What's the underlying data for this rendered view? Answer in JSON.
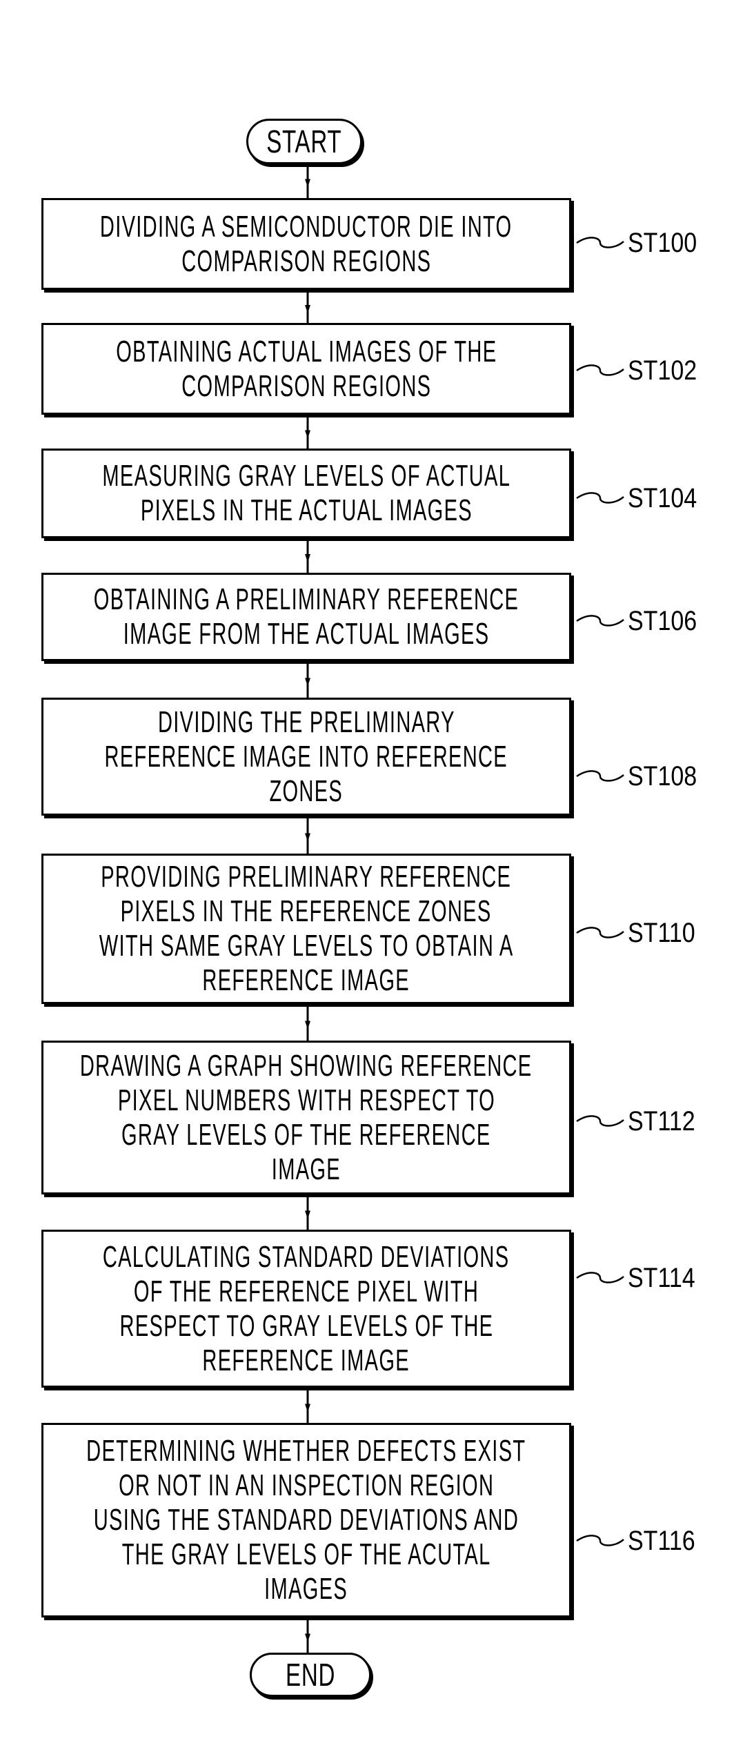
{
  "diagram": {
    "type": "flowchart",
    "start": {
      "label": "START"
    },
    "end": {
      "label": "END"
    },
    "steps": [
      {
        "id": "ST100",
        "lines": [
          "DIVIDING A SEMICONDUCTOR DIE INTO",
          "COMPARISON REGIONS"
        ]
      },
      {
        "id": "ST102",
        "lines": [
          "OBTAINING ACTUAL IMAGES OF THE",
          "COMPARISON REGIONS"
        ]
      },
      {
        "id": "ST104",
        "lines": [
          "MEASURING GRAY LEVELS OF ACTUAL",
          "PIXELS IN THE ACTUAL IMAGES"
        ]
      },
      {
        "id": "ST106",
        "lines": [
          "OBTAINING A PRELIMINARY REFERENCE",
          "IMAGE FROM THE ACTUAL IMAGES"
        ]
      },
      {
        "id": "ST108",
        "lines": [
          "DIVIDING THE PRELIMINARY",
          "REFERENCE IMAGE INTO REFERENCE",
          "ZONES"
        ]
      },
      {
        "id": "ST110",
        "lines": [
          "PROVIDING PRELIMINARY REFERENCE",
          "PIXELS IN THE REFERENCE ZONES",
          "WITH SAME GRAY LEVELS TO OBTAIN A",
          "REFERENCE IMAGE"
        ]
      },
      {
        "id": "ST112",
        "lines": [
          "DRAWING A GRAPH SHOWING REFERENCE",
          "PIXEL NUMBERS WITH RESPECT TO",
          "GRAY LEVELS OF THE REFERENCE",
          "IMAGE"
        ]
      },
      {
        "id": "ST114",
        "lines": [
          "CALCULATING STANDARD DEVIATIONS",
          "OF THE REFERENCE PIXEL WITH",
          "RESPECT TO GRAY LEVELS OF THE",
          "REFERENCE IMAGE"
        ]
      },
      {
        "id": "ST116",
        "lines": [
          "DETERMINING WHETHER DEFECTS EXIST",
          "OR NOT IN AN INSPECTION REGION",
          "USING THE STANDARD DEVIATIONS AND",
          "THE GRAY LEVELS OF THE ACUTAL",
          "IMAGES"
        ]
      }
    ]
  }
}
